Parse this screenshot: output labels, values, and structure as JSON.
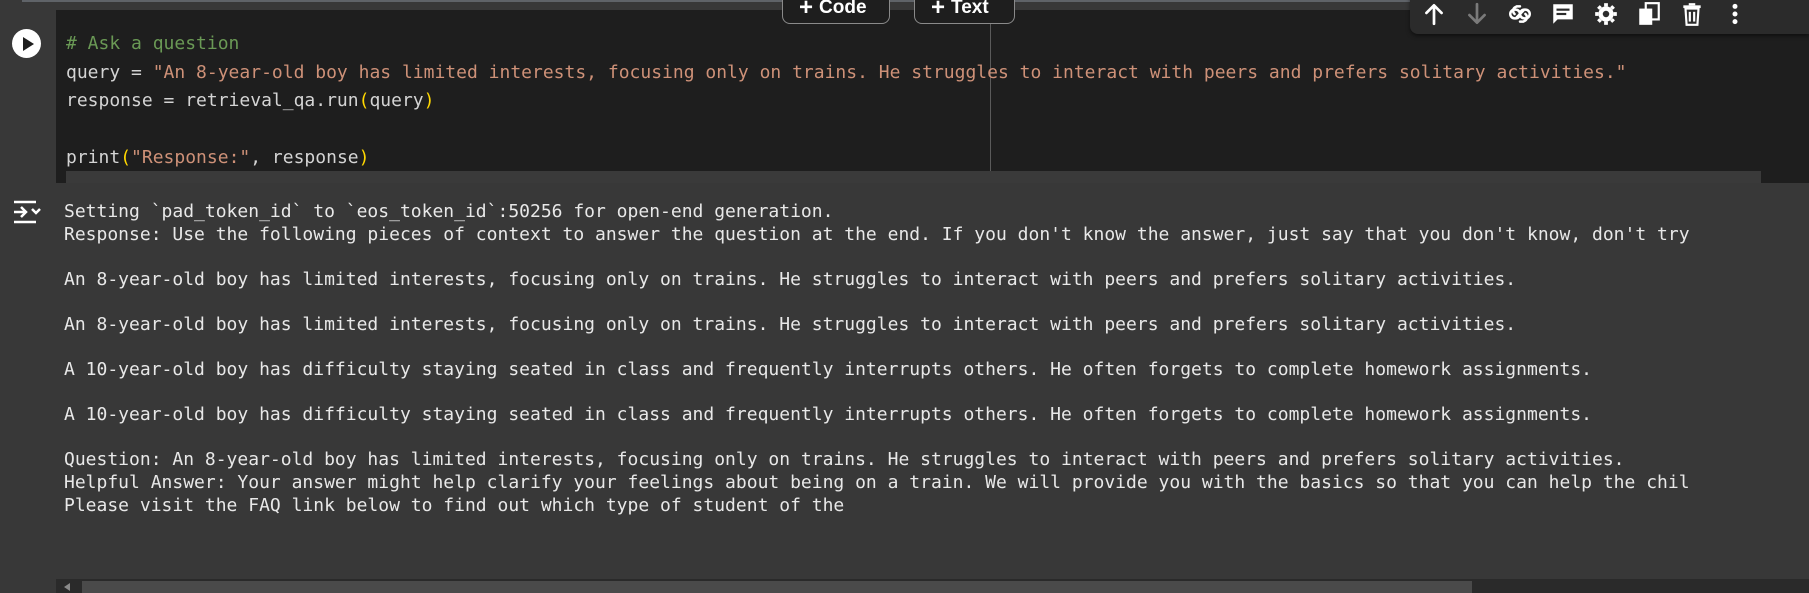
{
  "cell": {
    "code_lines": [
      {
        "parts": [
          {
            "cls": "c-comment",
            "text": "# Ask a question"
          }
        ]
      },
      {
        "parts": [
          {
            "cls": "",
            "text": "query = "
          },
          {
            "cls": "c-str",
            "text": "\"An 8-year-old boy has limited interests, focusing only on trains. He struggles to interact with peers and prefers solitary activities.\""
          }
        ]
      },
      {
        "parts": [
          {
            "cls": "",
            "text": "response = retrieval_qa.run"
          },
          {
            "cls": "c-paren",
            "text": "("
          },
          {
            "cls": "",
            "text": "query"
          },
          {
            "cls": "c-paren",
            "text": ")"
          }
        ]
      },
      {
        "parts": [
          {
            "cls": "",
            "text": ""
          }
        ]
      },
      {
        "parts": [
          {
            "cls": "",
            "text": "print"
          },
          {
            "cls": "c-paren",
            "text": "("
          },
          {
            "cls": "c-str",
            "text": "\"Response:\""
          },
          {
            "cls": "",
            "text": ", response"
          },
          {
            "cls": "c-paren",
            "text": ")"
          }
        ]
      }
    ]
  },
  "add_buttons": {
    "code_label": "Code",
    "text_label": "Text"
  },
  "toolbar_icons": [
    "move-up-icon",
    "move-down-icon",
    "link-icon",
    "comment-icon",
    "settings-icon",
    "mirror-cell-icon",
    "delete-icon",
    "more-options-icon"
  ],
  "output": {
    "lines": [
      "Setting `pad_token_id` to `eos_token_id`:50256 for open-end generation.",
      "Response: Use the following pieces of context to answer the question at the end. If you don't know the answer, just say that you don't know, don't try",
      "",
      "An 8-year-old boy has limited interests, focusing only on trains. He struggles to interact with peers and prefers solitary activities.",
      "",
      "An 8-year-old boy has limited interests, focusing only on trains. He struggles to interact with peers and prefers solitary activities.",
      "",
      "A 10-year-old boy has difficulty staying seated in class and frequently interrupts others. He often forgets to complete homework assignments.",
      "",
      "A 10-year-old boy has difficulty staying seated in class and frequently interrupts others. He often forgets to complete homework assignments.",
      "",
      "Question: An 8-year-old boy has limited interests, focusing only on trains. He struggles to interact with peers and prefers solitary activities.",
      "Helpful Answer: Your answer might help clarify your feelings about being on a train. We will provide you with the basics so that you can help the chil",
      "Please visit the FAQ link below to find out which type of student of the"
    ]
  },
  "colors": {
    "editor_bg": "#1e1e1e",
    "output_bg": "#383838",
    "comment": "#6a9955",
    "string": "#ce9178",
    "paren": "#ffd700"
  }
}
